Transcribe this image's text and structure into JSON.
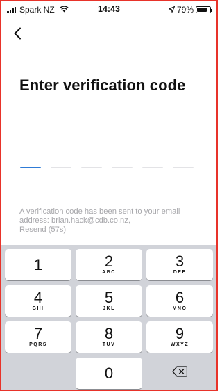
{
  "status_bar": {
    "carrier": "Spark NZ",
    "time": "14:43",
    "battery_percent": "79%",
    "battery_level": 0.79,
    "icons": [
      "signal-icon",
      "wifi-icon",
      "location-arrow-icon",
      "battery-icon"
    ]
  },
  "nav": {
    "back_icon": "chevron-left-icon"
  },
  "screen": {
    "title": "Enter verification code",
    "code_length": 6,
    "code_value": "",
    "info_text": "A verification code has been sent to your email address: brian.hack@cdb.co.nz,",
    "resend_label": "Resend (57s)"
  },
  "keypad": {
    "rows": [
      [
        {
          "digit": "1",
          "letters": ""
        },
        {
          "digit": "2",
          "letters": "ABC"
        },
        {
          "digit": "3",
          "letters": "DEF"
        }
      ],
      [
        {
          "digit": "4",
          "letters": "GHI"
        },
        {
          "digit": "5",
          "letters": "JKL"
        },
        {
          "digit": "6",
          "letters": "MNO"
        }
      ],
      [
        {
          "digit": "7",
          "letters": "PQRS"
        },
        {
          "digit": "8",
          "letters": "TUV"
        },
        {
          "digit": "9",
          "letters": "WXYZ"
        }
      ],
      [
        {
          "digit": "",
          "letters": ""
        },
        {
          "digit": "0",
          "letters": ""
        },
        {
          "digit": "",
          "letters": ""
        }
      ]
    ],
    "delete_icon": "backspace-icon"
  },
  "colors": {
    "accent": "#2f7bd6",
    "muted_text": "#a7a7ab",
    "keypad_bg": "#d1d3d9",
    "frame_border": "#e8332a"
  }
}
